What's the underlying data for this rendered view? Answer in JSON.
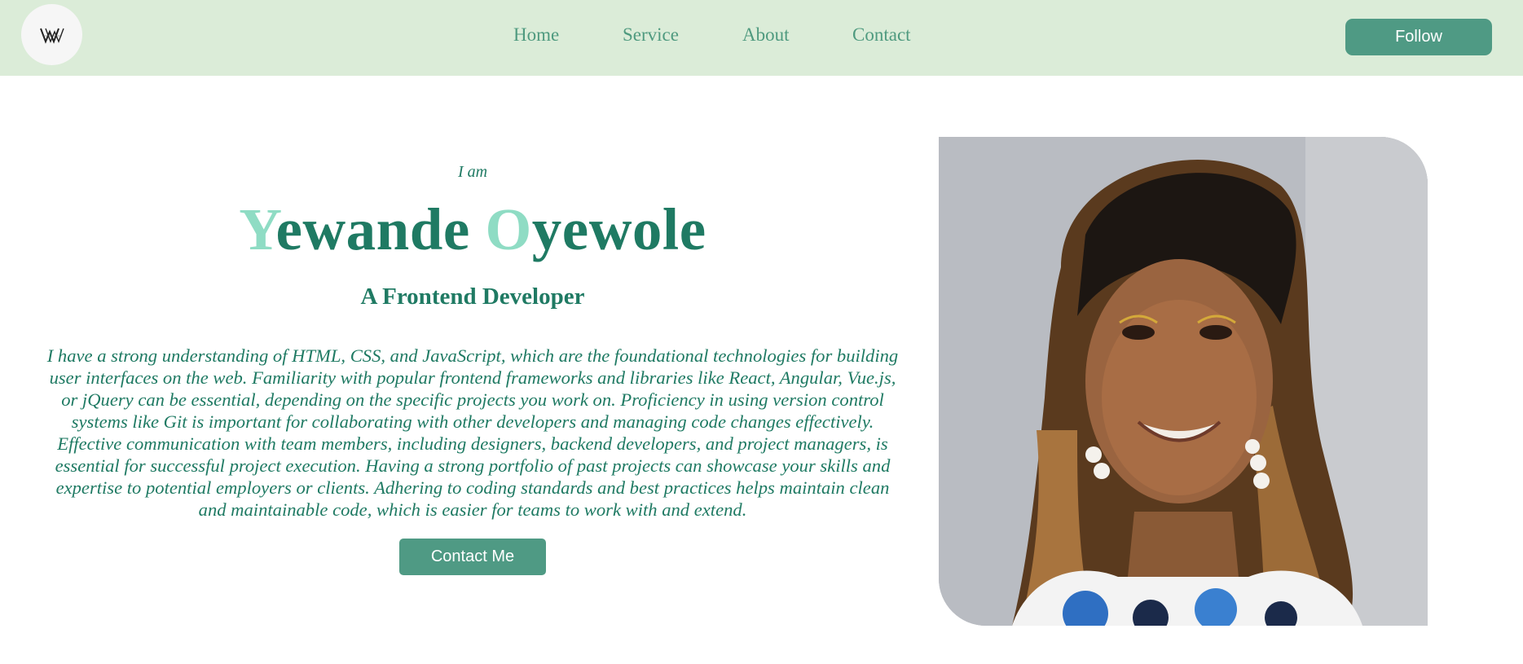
{
  "header": {
    "logo": {
      "icon": "w-monogram-logo"
    },
    "nav": [
      {
        "label": "Home"
      },
      {
        "label": "Service"
      },
      {
        "label": "About"
      },
      {
        "label": "Contact"
      }
    ],
    "follow_label": "Follow"
  },
  "hero": {
    "intro": "I am",
    "name": {
      "first_initial": "Y",
      "first_rest": "ewande",
      "last_initial": "O",
      "last_rest": "yewole"
    },
    "role": "A Frontend Developer",
    "bio": "I have a strong understanding of HTML, CSS, and JavaScript, which are the foundational technologies for building user interfaces on the web. Familiarity with popular frontend frameworks and libraries like React, Angular, Vue.js, or jQuery can be essential, depending on the specific projects you work on. Proficiency in using version control systems like Git is important for collaborating with other developers and managing code changes effectively. Effective communication with team members, including designers, backend developers, and project managers, is essential for successful project execution. Having a strong portfolio of past projects can showcase your skills and expertise to potential employers or clients. Adhering to coding standards and best practices helps maintain clean and maintainable code, which is easier for teams to work with and extend.",
    "contact_label": "Contact Me",
    "photo": {
      "icon": "profile-photo"
    }
  },
  "colors": {
    "nav_background": "#dbecd8",
    "accent_green": "#4f9a84",
    "text_green": "#1f7a63",
    "name_accent": "#8fdcc4"
  }
}
